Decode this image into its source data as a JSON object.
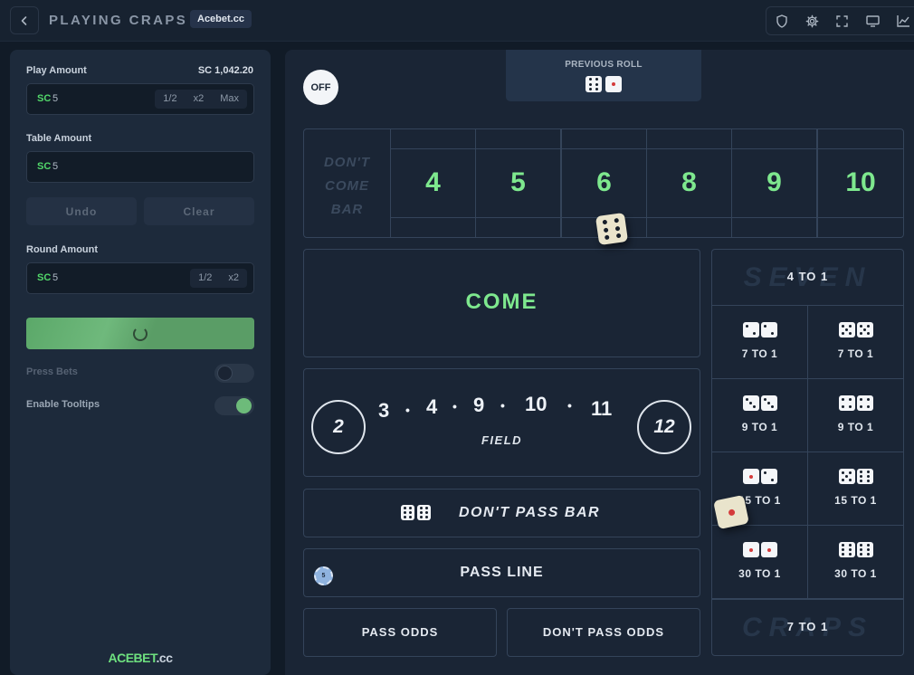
{
  "header": {
    "title": "PLAYING CRAPS",
    "brand_badge": "Acebet.cc",
    "icons": [
      "back-icon",
      "shield-icon",
      "gear-icon",
      "fullscreen-icon",
      "monitor-icon",
      "chart-icon"
    ]
  },
  "sidebar": {
    "play_amount_label": "Play Amount",
    "balance": "SC 1,042.20",
    "play_amount": {
      "currency": "SC",
      "value": "5",
      "buttons": [
        "1/2",
        "x2",
        "Max"
      ]
    },
    "table_amount_label": "Table Amount",
    "table_amount": {
      "currency": "SC",
      "value": "5"
    },
    "undo_label": "Undo",
    "clear_label": "Clear",
    "round_amount_label": "Round Amount",
    "round_amount": {
      "currency": "SC",
      "value": "5",
      "buttons": [
        "1/2",
        "x2"
      ]
    },
    "press_bets_label": "Press Bets",
    "press_bets_enabled": false,
    "tooltips_label": "Enable Tooltips",
    "tooltips_enabled": true,
    "logo_ace": "ACEBET",
    "logo_cc": ".cc"
  },
  "table": {
    "puck_label": "OFF",
    "previous_roll_label": "PREVIOUS ROLL",
    "previous_roll_dice": [
      6,
      1
    ],
    "dont_come_bar": [
      "DON'T",
      "COME",
      "BAR"
    ],
    "place_numbers": [
      "4",
      "5",
      "6",
      "8",
      "9",
      "10"
    ],
    "come_label": "COME",
    "field": {
      "left_circle": "2",
      "numbers": [
        "3",
        "4",
        "9",
        "10",
        "11"
      ],
      "right_circle": "12",
      "label": "FIELD"
    },
    "dont_pass_bar_label": "DON'T PASS BAR",
    "pass_line_label": "PASS LINE",
    "pass_line_chip": "5",
    "pass_odds_label": "PASS ODDS",
    "dont_pass_odds_label": "DON'T PASS ODDS",
    "seven_ghost": "SEVEN",
    "seven_payout": "4 TO 1",
    "craps_ghost": "CRAPS",
    "craps_payout": "7 TO 1",
    "proposition_bets": [
      {
        "dice": [
          2,
          2
        ],
        "payout": "7 TO 1"
      },
      {
        "dice": [
          5,
          5
        ],
        "payout": "7 TO 1"
      },
      {
        "dice": [
          3,
          3
        ],
        "payout": "9 TO 1"
      },
      {
        "dice": [
          4,
          4
        ],
        "payout": "9 TO 1"
      },
      {
        "dice": [
          1,
          2
        ],
        "payout": "15 TO 1"
      },
      {
        "dice": [
          5,
          6
        ],
        "payout": "15 TO 1"
      },
      {
        "dice": [
          1,
          1
        ],
        "payout": "30 TO 1"
      },
      {
        "dice": [
          6,
          6
        ],
        "payout": "30 TO 1"
      }
    ],
    "rolling_dice": [
      6,
      1
    ]
  }
}
